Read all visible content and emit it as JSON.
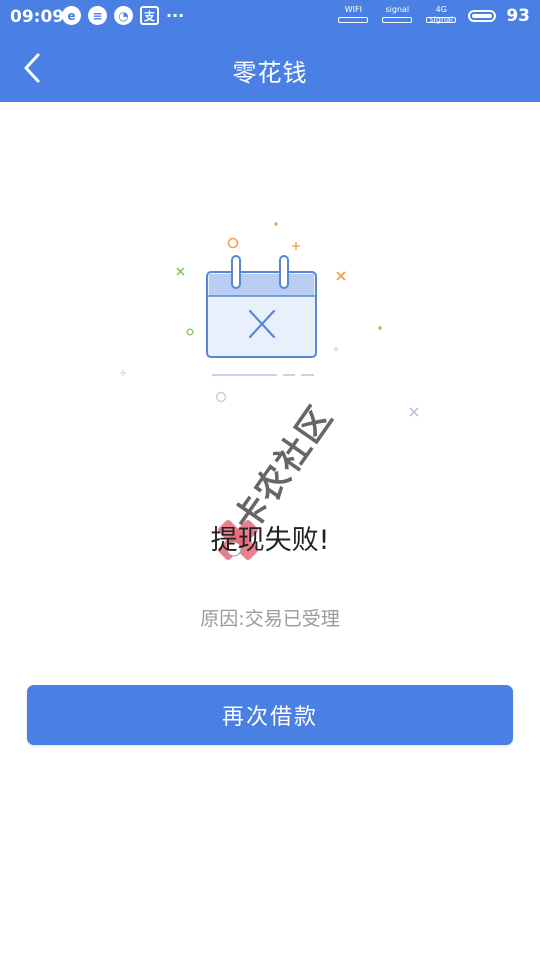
{
  "status_bar": {
    "time": "09:09",
    "notification_icons": [
      "e",
      "≡",
      "◔",
      "支"
    ],
    "overflow": "···",
    "wifi_label": "WIFI",
    "signal1_label": "signal",
    "signal2_label": "4G signal",
    "battery_level": "93"
  },
  "header": {
    "title": "零花钱"
  },
  "result": {
    "title": "提现失败!",
    "reason": "原因:交易已受理"
  },
  "actions": {
    "retry_label": "再次借款"
  },
  "watermark": {
    "text": "卡农社区"
  },
  "colors": {
    "primary": "#4a7fe3",
    "text_dark": "#222222",
    "text_muted": "#9a9a9a",
    "illustration_blue": "#5b86d6"
  }
}
